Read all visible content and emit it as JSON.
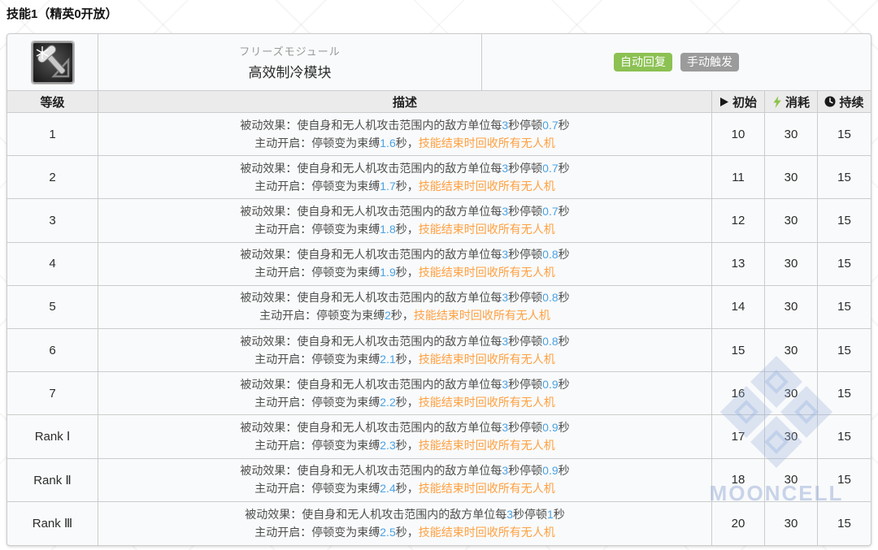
{
  "page": {
    "title": "技能1（精英0开放）"
  },
  "skill": {
    "name_jp": "フリーズモジュール",
    "name_cn": "高效制冷模块",
    "icon": "snowflake-mallet-icon",
    "badges": [
      {
        "label": "自动回复",
        "color": "#8cc153"
      },
      {
        "label": "手动触发",
        "color": "#9b9b9b"
      }
    ]
  },
  "table": {
    "headers": {
      "level": "等级",
      "desc": "描述",
      "initial": "初始",
      "cost": "消耗",
      "duration": "持续"
    },
    "header_icons": {
      "initial": "play-icon",
      "cost": "lightning-icon",
      "duration": "clock-icon"
    },
    "desc_template": {
      "passive_prefix": "被动效果：使自身和无人机攻击范围内的敌方单位每",
      "passive_infix": "秒停顿",
      "passive_suffix": "秒",
      "active_prefix": "主动开启：停顿变为束缚",
      "active_infix": "秒，",
      "active_highlight": "技能结束时回收所有无人机"
    },
    "rows": [
      {
        "level": "1",
        "interval": "3",
        "stop": "0.7",
        "bind": "1.6",
        "initial": "10",
        "cost": "30",
        "duration": "15"
      },
      {
        "level": "2",
        "interval": "3",
        "stop": "0.7",
        "bind": "1.7",
        "initial": "11",
        "cost": "30",
        "duration": "15"
      },
      {
        "level": "3",
        "interval": "3",
        "stop": "0.7",
        "bind": "1.8",
        "initial": "12",
        "cost": "30",
        "duration": "15"
      },
      {
        "level": "4",
        "interval": "3",
        "stop": "0.8",
        "bind": "1.9",
        "initial": "13",
        "cost": "30",
        "duration": "15"
      },
      {
        "level": "5",
        "interval": "3",
        "stop": "0.8",
        "bind": "2",
        "initial": "14",
        "cost": "30",
        "duration": "15"
      },
      {
        "level": "6",
        "interval": "3",
        "stop": "0.8",
        "bind": "2.1",
        "initial": "15",
        "cost": "30",
        "duration": "15"
      },
      {
        "level": "7",
        "interval": "3",
        "stop": "0.9",
        "bind": "2.2",
        "initial": "16",
        "cost": "30",
        "duration": "15"
      },
      {
        "level": "Rank Ⅰ",
        "interval": "3",
        "stop": "0.9",
        "bind": "2.3",
        "initial": "17",
        "cost": "30",
        "duration": "15"
      },
      {
        "level": "Rank Ⅱ",
        "interval": "3",
        "stop": "0.9",
        "bind": "2.4",
        "initial": "18",
        "cost": "30",
        "duration": "15"
      },
      {
        "level": "Rank Ⅲ",
        "interval": "3",
        "stop": "1",
        "bind": "2.5",
        "initial": "20",
        "cost": "30",
        "duration": "15"
      }
    ]
  },
  "watermark": {
    "text": "MOONCELL",
    "logo": "mooncell-diamond-logo"
  },
  "colors": {
    "value_blue": "#4ba3e3",
    "highlight_orange": "#ffa040",
    "lightning_green": "#8bc34a",
    "badge_green": "#8cc153",
    "badge_gray": "#9b9b9b"
  }
}
